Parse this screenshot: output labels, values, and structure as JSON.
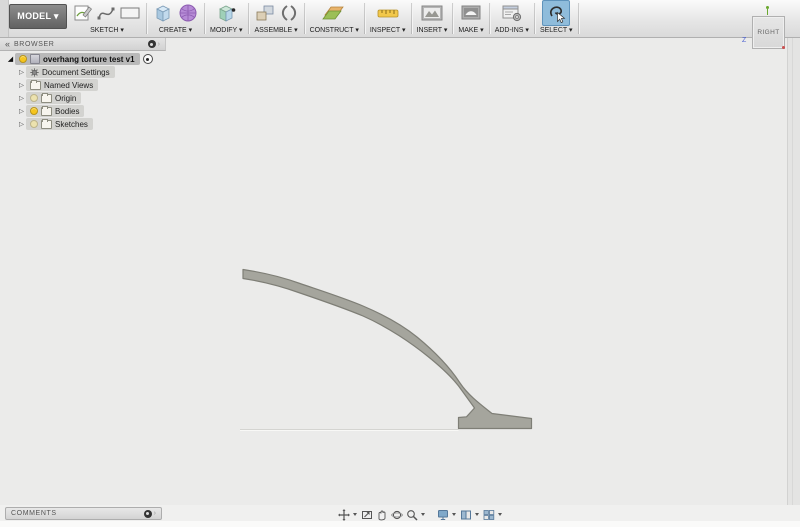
{
  "app": {
    "model_label": "MODEL ▾"
  },
  "toolbar": {
    "groups": [
      {
        "label": "SKETCH ▾",
        "icons": [
          "create-sketch-icon",
          "spline-icon",
          "rectangle-icon"
        ]
      },
      {
        "label": "CREATE ▾",
        "icons": [
          "extrude-icon",
          "form-icon"
        ]
      },
      {
        "label": "MODIFY ▾",
        "icons": [
          "press-pull-icon"
        ]
      },
      {
        "label": "ASSEMBLE ▾",
        "icons": [
          "new-component-icon",
          "joint-icon"
        ]
      },
      {
        "label": "CONSTRUCT ▾",
        "icons": [
          "construction-plane-icon"
        ]
      },
      {
        "label": "INSPECT ▾",
        "icons": [
          "measure-icon"
        ]
      },
      {
        "label": "INSERT ▾",
        "icons": [
          "insert-image-icon"
        ]
      },
      {
        "label": "MAKE ▾",
        "icons": [
          "make-icon"
        ]
      },
      {
        "label": "ADD-INS ▾",
        "icons": [
          "add-ins-icon"
        ]
      },
      {
        "label": "SELECT ▾",
        "icons": [
          "select-lasso-icon"
        ],
        "active": true
      }
    ]
  },
  "browser": {
    "title": "BROWSER",
    "root": {
      "label": "overhang torture test v1",
      "active": true,
      "bulb": "on"
    },
    "items": [
      {
        "label": "Document Settings",
        "icon": "gear"
      },
      {
        "label": "Named Views",
        "icon": "folder"
      },
      {
        "label": "Origin",
        "icon": "folder",
        "bulb": "dim"
      },
      {
        "label": "Bodies",
        "icon": "folder",
        "bulb": "on"
      },
      {
        "label": "Sketches",
        "icon": "folder",
        "bulb": "dim"
      }
    ]
  },
  "viewcube": {
    "face": "RIGHT",
    "z_label": "Z"
  },
  "comments": {
    "label": "COMMENTS"
  },
  "nav_bar": {
    "icons": [
      "pan-icon",
      "look-at-icon",
      "hand-icon",
      "orbit-icon",
      "zoom-icon",
      "display-settings-icon",
      "layout-grid-icon",
      "viewports-icon"
    ]
  },
  "canvas": {
    "colors": {
      "canvas_bg": "#ebebea",
      "body_fill": "#a5a59d",
      "body_outline": "#7e7e76",
      "select_highlight": "#8fbcdb",
      "bulb_on": "#f6c51d"
    }
  }
}
